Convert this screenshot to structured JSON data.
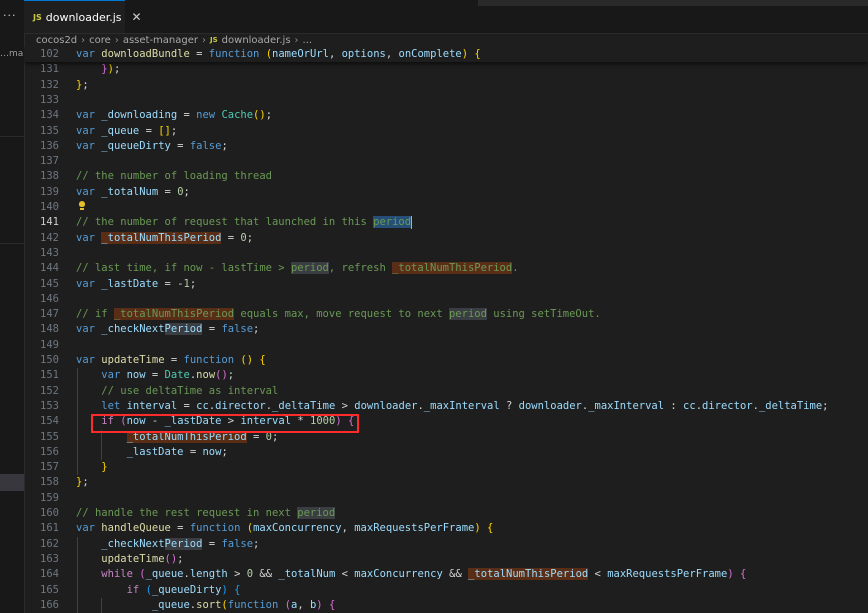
{
  "tab": {
    "badge": "JS",
    "label": "downloader.js",
    "close": "✕"
  },
  "sidebar": {
    "dots": "···",
    "clipped_label": "…mana…"
  },
  "breadcrumb": [
    "cocos2d",
    "core",
    "asset-manager",
    "downloader.js",
    "..."
  ],
  "sticky": {
    "line_number": "102",
    "text": "var downloadBundle = function (nameOrUrl, options, onComplete) {"
  },
  "lines": [
    {
      "n": "131",
      "t": "    });"
    },
    {
      "n": "132",
      "t": "};"
    },
    {
      "n": "133",
      "t": ""
    },
    {
      "n": "134",
      "t": "var _downloading = new Cache();"
    },
    {
      "n": "135",
      "t": "var _queue = [];"
    },
    {
      "n": "136",
      "t": "var _queueDirty = false;"
    },
    {
      "n": "137",
      "t": ""
    },
    {
      "n": "138",
      "t": "// the number of loading thread"
    },
    {
      "n": "139",
      "t": "var _totalNum = 0;"
    },
    {
      "n": "140",
      "t": ""
    },
    {
      "n": "141",
      "t": "// the number of request that launched in this period",
      "active": true
    },
    {
      "n": "142",
      "t": "var _totalNumThisPeriod = 0;"
    },
    {
      "n": "143",
      "t": ""
    },
    {
      "n": "144",
      "t": "// last time, if now - lastTime > period, refresh _totalNumThisPeriod."
    },
    {
      "n": "145",
      "t": "var _lastDate = -1;"
    },
    {
      "n": "146",
      "t": ""
    },
    {
      "n": "147",
      "t": "// if _totalNumThisPeriod equals max, move request to next period using setTimeOut."
    },
    {
      "n": "148",
      "t": "var _checkNextPeriod = false;"
    },
    {
      "n": "149",
      "t": ""
    },
    {
      "n": "150",
      "t": "var updateTime = function () {"
    },
    {
      "n": "151",
      "t": "    var now = Date.now();"
    },
    {
      "n": "152",
      "t": "    // use deltaTime as interval"
    },
    {
      "n": "153",
      "t": "    let interval = cc.director._deltaTime > downloader._maxInterval ? downloader._maxInterval : cc.director._deltaTime;"
    },
    {
      "n": "154",
      "t": "    if (now - _lastDate > interval * 1000) {"
    },
    {
      "n": "155",
      "t": "        _totalNumThisPeriod = 0;"
    },
    {
      "n": "156",
      "t": "        _lastDate = now;"
    },
    {
      "n": "157",
      "t": "    }"
    },
    {
      "n": "158",
      "t": "};"
    },
    {
      "n": "159",
      "t": ""
    },
    {
      "n": "160",
      "t": "// handle the rest request in next period"
    },
    {
      "n": "161",
      "t": "var handleQueue = function (maxConcurrency, maxRequestsPerFrame) {"
    },
    {
      "n": "162",
      "t": "    _checkNextPeriod = false;"
    },
    {
      "n": "163",
      "t": "    updateTime();"
    },
    {
      "n": "164",
      "t": "    while (_queue.length > 0 && _totalNum < maxConcurrency && _totalNumThisPeriod < maxRequestsPerFrame) {"
    },
    {
      "n": "165",
      "t": "        if (_queueDirty) {"
    },
    {
      "n": "166",
      "t": "            _queue.sort(function (a, b) {"
    }
  ],
  "colors": {
    "accent": "#0078d4",
    "highlight_box": "#ff2a2a",
    "word_highlight": "#5a2e16"
  }
}
